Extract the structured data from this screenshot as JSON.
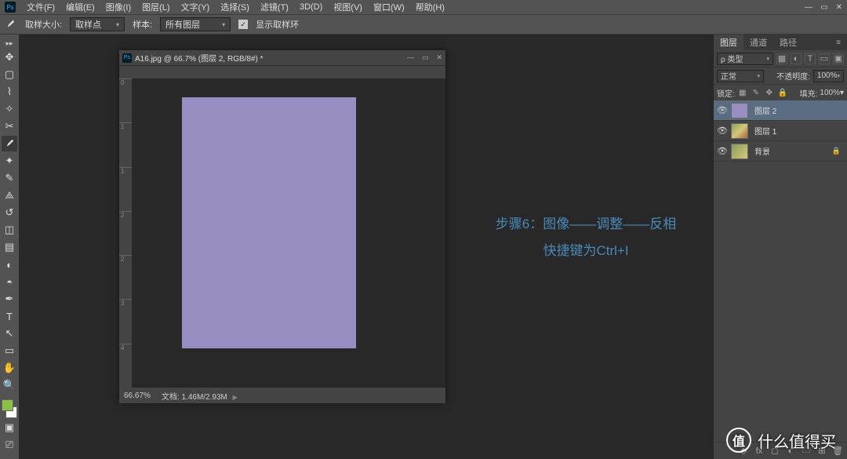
{
  "menu": {
    "file": "文件(F)",
    "edit": "编辑(E)",
    "image": "图像(I)",
    "layer": "图层(L)",
    "type": "文字(Y)",
    "select": "选择(S)",
    "filter": "滤镜(T)",
    "threed": "3D(D)",
    "view": "视图(V)",
    "window": "窗口(W)",
    "help": "帮助(H)"
  },
  "optbar": {
    "sample_size_lbl": "取样大小:",
    "sample_size_val": "取样点",
    "sample_lbl": "样本:",
    "sample_val": "所有图层",
    "show_ring": "显示取样环"
  },
  "doc": {
    "title": "A16.jpg @ 66.7% (图层 2, RGB/8#) *",
    "zoom": "66.67%",
    "status_lbl": "文档:",
    "status_val": "1.46M/2.93M",
    "ruler_marks": [
      "0",
      "1",
      "1",
      "2",
      "2",
      "3",
      "4"
    ]
  },
  "annot": {
    "line1": "步骤6：图像——调整——反相",
    "line2": "快捷键为Ctrl+I"
  },
  "panels": {
    "tabs": {
      "layers": "图层",
      "channels": "通道",
      "paths": "路径"
    },
    "kind": "ρ 类型",
    "blend": "正常",
    "opacity_lbl": "不透明度:",
    "opacity": "100%",
    "lock_lbl": "锁定:",
    "fill_lbl": "填充:",
    "fill": "100%",
    "layers_list": [
      {
        "name": "图层 2",
        "thumb": "purple",
        "sel": true
      },
      {
        "name": "图层 1",
        "thumb": "img",
        "sel": false
      },
      {
        "name": "背景",
        "thumb": "bg",
        "sel": false,
        "locked": true
      }
    ]
  },
  "watermark": "什么值得买"
}
